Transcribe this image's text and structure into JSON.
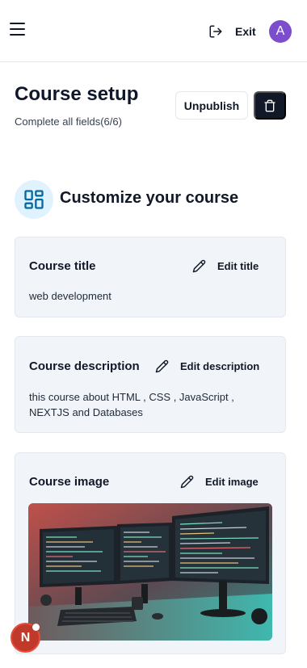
{
  "header": {
    "exit_label": "Exit",
    "avatar_initial": "A",
    "avatar_color": "#7c4dcc"
  },
  "setup": {
    "title": "Course setup",
    "subtitle": "Complete all fields(6/6)",
    "unpublish_label": "Unpublish"
  },
  "section": {
    "title": "Customize your course",
    "icon": "layout-dashboard-icon"
  },
  "cards": {
    "title": {
      "label": "Course title",
      "edit_label": "Edit title",
      "value": "web development"
    },
    "description": {
      "label": "Course description",
      "edit_label": "Edit description",
      "value": "this course about HTML , CSS , JavaScript , NEXTJS and Databases"
    },
    "image": {
      "label": "Course image",
      "edit_label": "Edit image"
    }
  },
  "badge": {
    "letter": "N"
  },
  "colors": {
    "primary_dark": "#111827",
    "card_bg": "#f1f5f9",
    "icon_bg": "#e0f2fe",
    "icon_accent": "#0369a1"
  }
}
